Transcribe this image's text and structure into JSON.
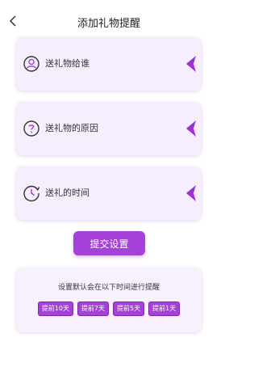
{
  "header": {
    "title": "添加礼物提醒"
  },
  "cards": [
    {
      "label": "送礼物给谁",
      "icon": "person-circle-icon"
    },
    {
      "label": "送礼物的原因",
      "icon": "question-circle-icon"
    },
    {
      "label": "送礼的时间",
      "icon": "clock-icon"
    }
  ],
  "submit_label": "提交设置",
  "reminder": {
    "title": "设置默认会在以下时间进行提醒",
    "options": [
      "提前10天",
      "提前7天",
      "提前5天",
      "提前1天"
    ]
  },
  "colors": {
    "accent": "#a540d8",
    "card_bg": "#f6eefd",
    "text": "#333333"
  }
}
